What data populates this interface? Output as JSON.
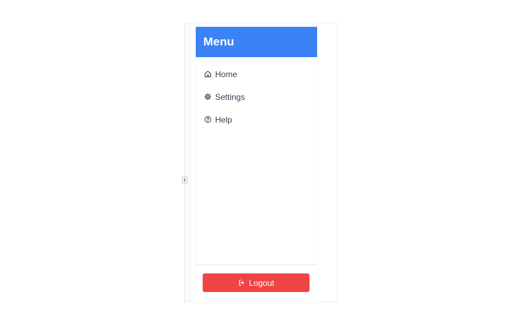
{
  "sidebar": {
    "title": "Menu",
    "items": [
      {
        "label": "Home",
        "icon": "home-icon"
      },
      {
        "label": "Settings",
        "icon": "gear-icon"
      },
      {
        "label": "Help",
        "icon": "help-circle-icon"
      }
    ],
    "logout_label": "Logout",
    "logout_icon": "logout-icon"
  },
  "colors": {
    "header": "#3b82f6",
    "logout": "#ef4444",
    "text": "#374151"
  }
}
